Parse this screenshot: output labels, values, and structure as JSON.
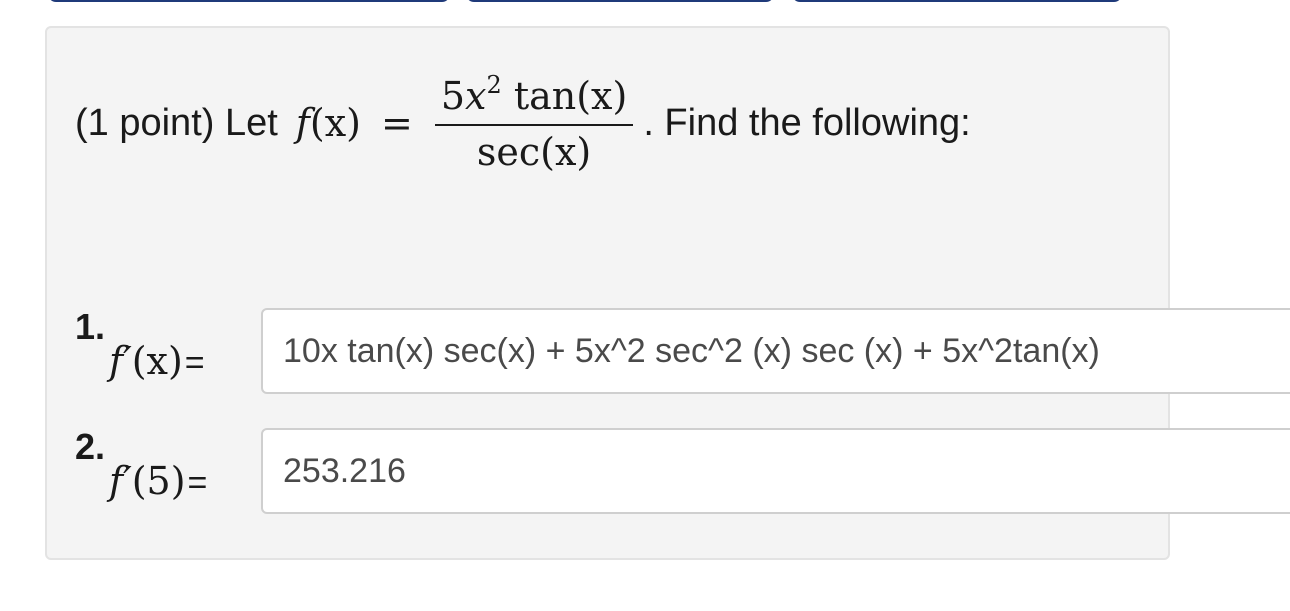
{
  "problem": {
    "intro": "(1 point) Let",
    "func_name": "f",
    "func_arg": "(x)",
    "equals": "=",
    "numerator": {
      "coef": "5",
      "var": "x",
      "exp": "2",
      "fn": "tan",
      "arg": "(x)"
    },
    "denominator": {
      "fn": "sec",
      "arg": "(x)"
    },
    "outro": ". Find the following:"
  },
  "questions": [
    {
      "number": "1.",
      "label_fn": "f′",
      "label_arg": "(x)",
      "equals": "=",
      "answer": "10x tan(x) sec(x) + 5x^2 sec^2 (x) sec (x) + 5x^2tan(x)"
    },
    {
      "number": "2.",
      "label_fn": "f′",
      "label_arg": "(5)",
      "equals": "=",
      "answer": "253.216"
    }
  ],
  "colors": {
    "nav_button": "#1f3a7a",
    "panel_background": "#f4f4f4",
    "input_border": "#cfcfcf"
  }
}
